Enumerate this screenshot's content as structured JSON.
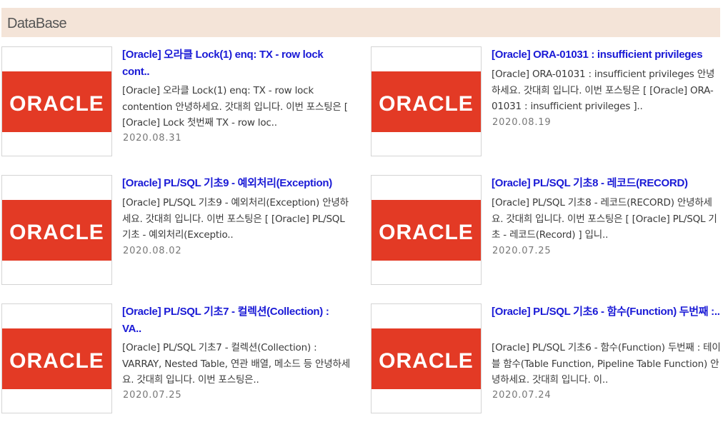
{
  "section": {
    "title": "DataBase"
  },
  "logo": {
    "text": "ORACLE",
    "background": "#e33a25",
    "color": "#ffffff"
  },
  "colors": {
    "title": "#1a1ad6",
    "header_bg": "#f4e4d8"
  },
  "posts": [
    {
      "title": "[Oracle] 오라클 Lock(1) enq: TX - row lock cont..",
      "excerpt": "[Oracle] 오라클 Lock(1) enq: TX - row lock contention 안녕하세요. 갓대희 입니다. 이번 포스팅은 [ [Oracle] Lock 첫번째 TX - row loc..",
      "date": "2020.08.31"
    },
    {
      "title": "[Oracle] ORA-01031 : insufficient privileges",
      "excerpt": "[Oracle] ORA-01031 : insufficient privileges 안녕하세요. 갓대희 입니다. 이번 포스팅은 [ [Oracle] ORA-01031 : insufficient privileges ]..",
      "date": "2020.08.19"
    },
    {
      "title": "[Oracle] PL/SQL 기초9 - 예외처리(Exception)",
      "excerpt": "[Oracle] PL/SQL 기초9 - 예외처리(Exception) 안녕하세요. 갓대희 입니다. 이번 포스팅은 [ [Oracle] PL/SQL 기초 - 예외처리(Exceptio..",
      "date": "2020.08.02"
    },
    {
      "title": "[Oracle] PL/SQL 기초8 - 레코드(RECORD)",
      "excerpt": "[Oracle] PL/SQL 기초8 - 레코드(RECORD) 안녕하세요. 갓대희 입니다. 이번 포스팅은 [ [Oracle] PL/SQL 기초 - 레코드(Record) ] 입니..",
      "date": "2020.07.25"
    },
    {
      "title": "[Oracle] PL/SQL 기초7 - 컬렉션(Collection) : VA..",
      "excerpt": "[Oracle] PL/SQL 기초7 - 컬렉션(Collection) : VARRAY, Nested Table, 연관 배열, 메소드 등 안녕하세요. 갓대희 입니다. 이번 포스팅은..",
      "date": "2020.07.25"
    },
    {
      "title": "[Oracle] PL/SQL 기초6 - 함수(Function) 두번째 :..",
      "excerpt": "[Oracle] PL/SQL 기초6 - 함수(Function) 두번째 : 테이블 함수(Table Function, Pipeline Table Function) 안녕하세요. 갓대희 입니다. 이..",
      "date": "2020.07.24"
    }
  ]
}
